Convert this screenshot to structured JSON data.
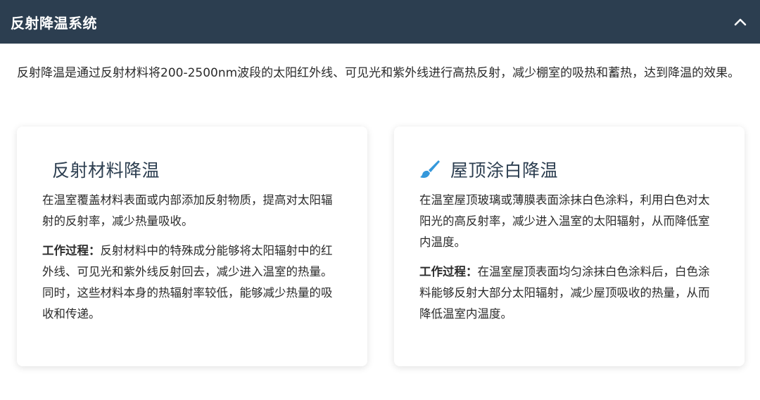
{
  "header": {
    "title": "反射降温系统",
    "toggle_icon": "chevron-up-icon"
  },
  "intro": "反射降温是通过反射材料将200-2500nm波段的太阳红外线、可见光和紫外线进行高热反射，减少棚室的吸热和蓄热，达到降温的效果。",
  "cards": [
    {
      "title": "反射材料降温",
      "description": "在温室覆盖材料表面或内部添加反射物质，提高对太阳辐射的反射率，减少热量吸收。",
      "process_label": "工作过程：",
      "process_text": "反射材料中的特殊成分能够将太阳辐射中的红外线、可见光和紫外线反射回去，减少进入温室的热量。同时，这些材料本身的热辐射率较低，能够减少热量的吸收和传递。"
    },
    {
      "title": "屋顶涂白降温",
      "icon": "paint-brush-icon",
      "icon_color": "#3498db",
      "description": "在温室屋顶玻璃或薄膜表面涂抹白色涂料，利用白色对太阳光的高反射率，减少进入温室的太阳辐射，从而降低室内温度。",
      "process_label": "工作过程：",
      "process_text": "在温室屋顶表面均匀涂抹白色涂料后，白色涂料能够反射大部分太阳辐射，减少屋顶吸收的热量，从而降低温室内温度。"
    }
  ],
  "colors": {
    "header_bg": "#2c3e50",
    "accent": "#3498db"
  }
}
